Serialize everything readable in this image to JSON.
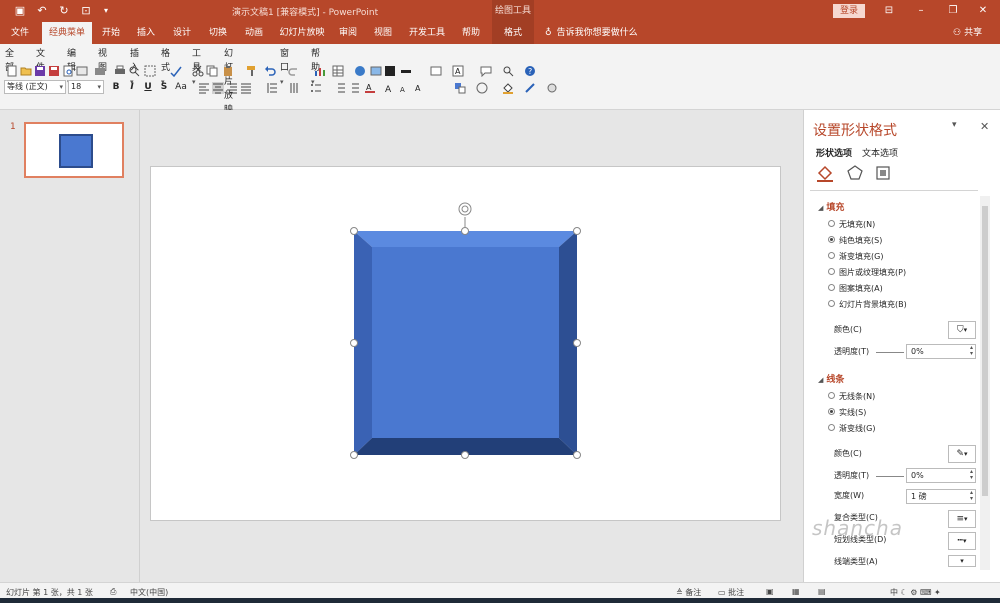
{
  "titlebar": {
    "title": "演示文稿1 [兼容模式] - PowerPoint",
    "context_tool": "绘图工具",
    "login": "登录"
  },
  "tabs": [
    "文件",
    "经典菜单",
    "开始",
    "插入",
    "设计",
    "切换",
    "动画",
    "幻灯片放映",
    "审阅",
    "视图",
    "开发工具",
    "帮助",
    "格式"
  ],
  "tell_me": "告诉我你想要做什么",
  "share": "共享",
  "menus": [
    "全部",
    "文件",
    "编辑",
    "视图",
    "插入",
    "格式",
    "工具",
    "幻灯片放映",
    "窗口",
    "帮助"
  ],
  "font": {
    "name": "等线 (正文)",
    "size": "18"
  },
  "format_buttons": [
    "B",
    "I",
    "U",
    "S",
    "Aa"
  ],
  "thumbnail": {
    "number": "1"
  },
  "format_pane": {
    "title": "设置形状格式",
    "tab_shape": "形状选项",
    "tab_text": "文本选项",
    "fill": {
      "heading": "填充",
      "options": [
        "无填充(N)",
        "纯色填充(S)",
        "渐变填充(G)",
        "图片或纹理填充(P)",
        "图案填充(A)",
        "幻灯片背景填充(B)"
      ],
      "selected": 1,
      "color_label": "颜色(C)",
      "transparency_label": "透明度(T)",
      "transparency_value": "0%"
    },
    "line": {
      "heading": "线条",
      "options": [
        "无线条(N)",
        "实线(S)",
        "渐变线(G)"
      ],
      "selected": 1,
      "color_label": "颜色(C)",
      "transparency_label": "透明度(T)",
      "transparency_value": "0%",
      "width_label": "宽度(W)",
      "width_value": "1 磅",
      "compound_label": "复合类型(C)",
      "dash_label": "短划线类型(D)",
      "cap_label": "线端类型(A)"
    }
  },
  "status": {
    "slide_info": "幻灯片 第 1 张，共 1 张",
    "language": "中文(中国)",
    "notes": "备注",
    "comments": "批注"
  },
  "watermark": "shancha",
  "colors": {
    "accent": "#b7472a",
    "shape_front": "#4a78d0",
    "shape_top": "#5b8ae0",
    "shape_left": "#3a62b4",
    "shape_right": "#2d4f93",
    "shape_bottom": "#223f78"
  }
}
